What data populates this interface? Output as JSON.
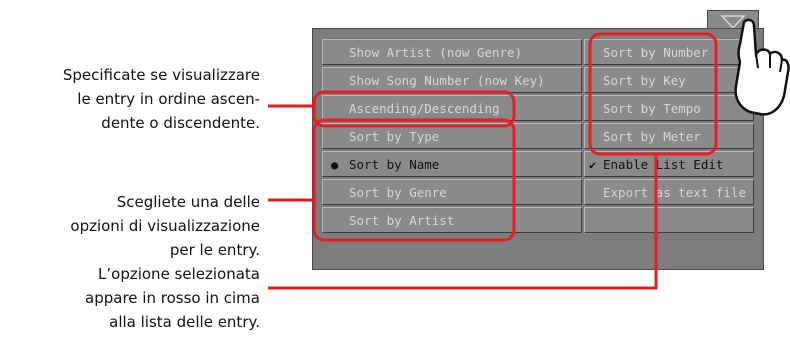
{
  "callouts": {
    "order": [
      "Specificate se visualizzare",
      "le entry in ordine ascen-",
      "dente o discendente."
    ],
    "view": [
      "Scegliete una delle",
      "opzioni di visualizzazione",
      "per le entry.",
      "L’opzione selezionata",
      "appare in rosso in cima",
      "alla lista delle entry."
    ]
  },
  "menu": {
    "left_column": [
      {
        "label": "Show Artist (now Genre)",
        "selected": false
      },
      {
        "label": "Show Song Number (now Key)",
        "selected": false
      },
      {
        "label": "Ascending/Descending",
        "selected": false
      },
      {
        "label": "Sort by Type",
        "selected": false
      },
      {
        "label": "Sort by Name",
        "selected": true
      },
      {
        "label": "Sort by Genre",
        "selected": false
      },
      {
        "label": "Sort by Artist",
        "selected": false
      }
    ],
    "right_column": [
      {
        "label": "Sort by Number",
        "checked": false
      },
      {
        "label": "Sort by Key",
        "checked": false
      },
      {
        "label": "Sort by Tempo",
        "checked": false
      },
      {
        "label": "Sort by Meter",
        "checked": false
      },
      {
        "label": "Enable List Edit",
        "checked": true
      },
      {
        "label": "Export as text file",
        "checked": false
      }
    ],
    "bullet_symbol": "●",
    "check_symbol": "✔"
  },
  "colors": {
    "highlight": "#e31e24",
    "panel": "#7d7d7d",
    "button": "#8a8a8a",
    "button_text": "#d8d8d8"
  }
}
